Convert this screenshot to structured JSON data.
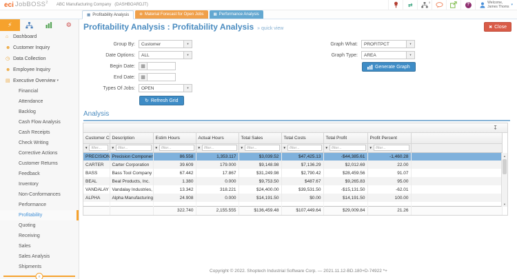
{
  "header": {
    "logo_eci": "eci",
    "logo_jobboss": "JobBOSS",
    "logo_sup": "2",
    "company": "ABC Manufacturing Company",
    "dashboard_tag": "(DASHBOARDJT)",
    "sitemap_badge": "0",
    "help_glyph": "?",
    "welcome_line1": "Welcome,",
    "welcome_line2": "James Thoms"
  },
  "tabs": [
    {
      "label": "Profitability Analysis",
      "active": true,
      "bg": "#ffffff",
      "fg": "#555555"
    },
    {
      "label": "Material Forecast for Open Jobs",
      "active": false,
      "bg": "#f0a04a",
      "fg": "#ffffff"
    },
    {
      "label": "Performance Analysis",
      "active": false,
      "bg": "#64a8d1",
      "fg": "#ffffff"
    }
  ],
  "sidebar": {
    "main_items": [
      {
        "label": "Dashboard",
        "icon": "home"
      },
      {
        "label": "Customer Inquiry",
        "icon": "user"
      },
      {
        "label": "Data Collection",
        "icon": "clock"
      },
      {
        "label": "Employee Inquiry",
        "icon": "user"
      },
      {
        "label": "Executive Overview",
        "icon": "briefcase",
        "expanded": true
      }
    ],
    "sub_items": [
      "Financial",
      "Attendance",
      "Backlog",
      "Cash Flow Analysis",
      "Cash Receipts",
      "Check Writing",
      "Corrective Actions",
      "Customer Returns",
      "Feedback",
      "Inventory",
      "Non-Conformances",
      "Performance",
      "Profitability",
      "Quoting",
      "Receiving",
      "Sales",
      "Sales Analysis",
      "Shipments"
    ],
    "active_sub": "Profitability"
  },
  "page": {
    "title": "Profitability Analysis : Profitability Analysis",
    "quick_view": "» quick view",
    "close_label": "Close"
  },
  "form": {
    "group_by_label": "Group By:",
    "group_by_value": "Customer",
    "date_options_label": "Date Options:",
    "date_options_value": "ALL",
    "begin_date_label": "Begin Date:",
    "begin_date_value": "",
    "end_date_label": "End Date:",
    "end_date_value": "",
    "types_of_jobs_label": "Types Of Jobs:",
    "types_of_jobs_value": "OPEN",
    "refresh_grid_label": "Refresh Grid",
    "graph_what_label": "Graph What:",
    "graph_what_value": "PROFITPCT",
    "graph_type_label": "Graph Type:",
    "graph_type_value": "AREA",
    "generate_graph_label": "Generate Graph"
  },
  "analysis": {
    "heading": "Analysis",
    "filter_placeholder": "filter...",
    "columns": [
      "Customer Code",
      "Description",
      "Estim Hours",
      "Actual Hours",
      "Total Sales",
      "Total Costs",
      "Total Profit",
      "Profit Percent"
    ],
    "rows": [
      {
        "cells": [
          "PRECISION",
          "Precision Components,...",
          "86.558",
          "1,353.117",
          "$3,039.52",
          "$47,425.13",
          "-$44,385.61",
          "-1,460.28"
        ],
        "selected": true
      },
      {
        "cells": [
          "CARTER",
          "Carter Corporation",
          "39.609",
          "179.000",
          "$9,148.98",
          "$7,136.29",
          "$2,012.69",
          "22.00"
        ],
        "selected": false
      },
      {
        "cells": [
          "BASS",
          "Bass Tool Company",
          "67.442",
          "17.867",
          "$31,249.98",
          "$2,790.42",
          "$28,459.56",
          "91.07"
        ],
        "selected": false
      },
      {
        "cells": [
          "BEAL",
          "Beal Products, Inc.",
          "1.380",
          "0.000",
          "$9,753.50",
          "$487.67",
          "$9,265.83",
          "95.00"
        ],
        "selected": false
      },
      {
        "cells": [
          "VANDALAY",
          "Vandalay Industries, Inc.",
          "13.342",
          "318.221",
          "$24,400.00",
          "$39,531.50",
          "-$15,131.50",
          "-62.01"
        ],
        "selected": false
      },
      {
        "cells": [
          "ALPHA",
          "Alpha Manufacturing, I...",
          "24.908",
          "0.000",
          "$14,191.50",
          "$0.00",
          "$14,191.50",
          "100.00"
        ],
        "selected": false
      }
    ],
    "totals": [
      "",
      "",
      "322.740",
      "2,155.555",
      "$136,459.48",
      "$107,449.64",
      "$29,009.84",
      "21.26"
    ]
  },
  "footer": {
    "text": "Copyright © 2022. Shoptech Industrial Software Corp. — 2021.11.12-BD.180+D-74922 *+"
  },
  "colors": {
    "accent_orange": "#f6a22d",
    "brand_orange": "#f26822",
    "link_blue": "#4b8cc0",
    "button_blue": "#3e8cc6",
    "close_red": "#d95b47",
    "selected_row": "#7fb1dc",
    "tab_material": "#f0a04a",
    "tab_performance": "#64a8d1"
  },
  "icons": {
    "bolt": "⚡",
    "gears": "⚙",
    "sync": "⇄",
    "grid_tab": "▦",
    "material_tab": "⊛",
    "home": "⌂",
    "user": "☻",
    "clock": "◷",
    "briefcase": "▤",
    "chevron_down": "▾",
    "calendar": "▦",
    "caret": "▾",
    "funnel": "▼",
    "refresh": "↻",
    "close": "✖",
    "export": "↧",
    "collapse": "«",
    "arrow_up": "▲",
    "arrow_down": "▼"
  }
}
